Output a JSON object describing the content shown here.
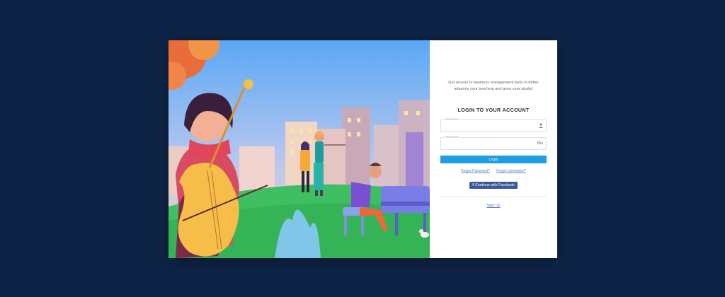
{
  "colors": {
    "page_bg": "#0e2446",
    "accent": "#1d9ee0",
    "facebook": "#3b5998"
  },
  "login_panel": {
    "intro": "Get access to business management tools to better advance your teaching and grow your studio!",
    "heading": "LOGIN TO YOUR ACCOUNT",
    "username": {
      "label": "Username",
      "value": "",
      "icon": "user-icon"
    },
    "password": {
      "label": "Password",
      "value": "",
      "icon": "key-icon"
    },
    "login_label": "Login",
    "forgot_password": "Forgot Password?",
    "forgot_username": "Forgot Username?",
    "facebook_label": "Continue with Facebook",
    "signup_label": "Sign Up"
  }
}
